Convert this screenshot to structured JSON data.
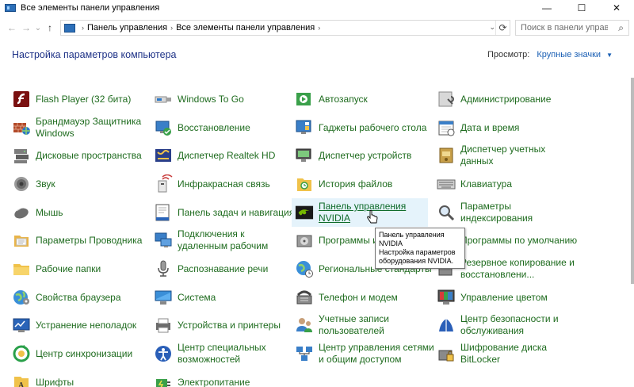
{
  "window": {
    "title": "Все элементы панели управления",
    "controls": {
      "minimize": "—",
      "maximize": "☐",
      "close": "✕"
    }
  },
  "nav": {
    "back": "←",
    "forward": "→",
    "recent": "⌄",
    "up": "↑",
    "breadcrumb": [
      "Панель управления",
      "Все элементы панели управления"
    ],
    "refresh": "⟳",
    "search_placeholder": "Поиск в панели управления"
  },
  "heading": "Настройка параметров компьютера",
  "view_by": {
    "label": "Просмотр:",
    "value": "Крупные значки"
  },
  "tooltip": {
    "lines": [
      "Панель управления NVIDIA",
      "Настройка параметров",
      "оборудования NVIDIA."
    ]
  },
  "colors": {
    "link": "#1e6b1e",
    "heading": "#1e3287",
    "accent": "#1a5fb4",
    "hover_bg": "#e5f3fb"
  },
  "columns": [
    [
      {
        "label": "Flash Player (32 бита)",
        "icon": "flash-icon"
      },
      {
        "label": "Брандмауэр Защитника Windows",
        "icon": "firewall-icon"
      },
      {
        "label": "Дисковые пространства",
        "icon": "storage-spaces-icon"
      },
      {
        "label": "Звук",
        "icon": "sound-icon"
      },
      {
        "label": "Мышь",
        "icon": "mouse-icon"
      },
      {
        "label": "Параметры Проводника",
        "icon": "explorer-options-icon"
      },
      {
        "label": "Рабочие папки",
        "icon": "work-folders-icon"
      },
      {
        "label": "Свойства браузера",
        "icon": "internet-options-icon"
      },
      {
        "label": "Устранение неполадок",
        "icon": "troubleshoot-icon"
      },
      {
        "label": "Центр синхронизации",
        "icon": "sync-center-icon"
      },
      {
        "label": "Шрифты",
        "icon": "fonts-icon"
      }
    ],
    [
      {
        "label": "Windows To Go",
        "icon": "usb-icon"
      },
      {
        "label": "Восстановление",
        "icon": "recovery-icon"
      },
      {
        "label": "Диспетчер Realtek HD",
        "icon": "realtek-icon"
      },
      {
        "label": "Инфракрасная связь",
        "icon": "infrared-icon"
      },
      {
        "label": "Панель задач и навигация",
        "icon": "taskbar-icon"
      },
      {
        "label": "Подключения к удаленным рабочим",
        "icon": "remote-desktop-icon"
      },
      {
        "label": "Распознавание речи",
        "icon": "microphone-icon"
      },
      {
        "label": "Система",
        "icon": "system-icon"
      },
      {
        "label": "Устройства и принтеры",
        "icon": "printer-icon"
      },
      {
        "label": "Центр специальных возможностей",
        "icon": "ease-of-access-icon"
      },
      {
        "label": "Электропитание",
        "icon": "power-icon"
      }
    ],
    [
      {
        "label": "Автозапуск",
        "icon": "autoplay-icon"
      },
      {
        "label": "Гаджеты рабочего стола",
        "icon": "gadgets-icon"
      },
      {
        "label": "Диспетчер устройств",
        "icon": "device-manager-icon"
      },
      {
        "label": "История файлов",
        "icon": "file-history-icon"
      },
      {
        "label": "Панель управления NVIDIA",
        "icon": "nvidia-icon",
        "hover": true
      },
      {
        "label": "Программы и компоненты",
        "icon": "programs-icon"
      },
      {
        "label": "Региональные стандарты",
        "icon": "region-icon"
      },
      {
        "label": "Телефон и модем",
        "icon": "phone-modem-icon"
      },
      {
        "label": "Учетные записи пользователей",
        "icon": "user-accounts-icon"
      },
      {
        "label": "Центр управления сетями и общим доступом",
        "icon": "network-icon"
      }
    ],
    [
      {
        "label": "Администрирование",
        "icon": "admin-tools-icon"
      },
      {
        "label": "Дата и время",
        "icon": "date-time-icon"
      },
      {
        "label": "Диспетчер учетных данных",
        "icon": "credential-manager-icon"
      },
      {
        "label": "Клавиатура",
        "icon": "keyboard-icon"
      },
      {
        "label": "Параметры индексирования",
        "icon": "indexing-icon"
      },
      {
        "label": "Программы по умолчанию",
        "icon": "default-programs-icon"
      },
      {
        "label": "Резервное копирование и восстановлени...",
        "icon": "backup-icon"
      },
      {
        "label": "Управление цветом",
        "icon": "color-management-icon"
      },
      {
        "label": "Центр безопасности и обслуживания",
        "icon": "security-center-icon"
      },
      {
        "label": "Шифрование диска BitLocker",
        "icon": "bitlocker-icon"
      }
    ]
  ]
}
